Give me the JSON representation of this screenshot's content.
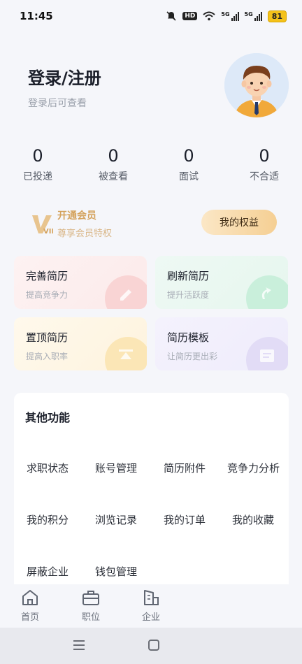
{
  "status_bar": {
    "time": "11:45",
    "hd": "HD",
    "net1": "5G",
    "net2": "5G",
    "battery": "81"
  },
  "profile": {
    "title": "登录/注册",
    "subtitle": "登录后可查看"
  },
  "stats": [
    {
      "value": "0",
      "label": "已投递"
    },
    {
      "value": "0",
      "label": "被查看"
    },
    {
      "value": "0",
      "label": "面试"
    },
    {
      "value": "0",
      "label": "不合适"
    }
  ],
  "vip": {
    "logo_text": "VIP",
    "title": "开通会员",
    "subtitle": "尊享会员特权",
    "button": "我的权益"
  },
  "cards": [
    {
      "title": "完善简历",
      "subtitle": "提高竞争力"
    },
    {
      "title": "刷新简历",
      "subtitle": "提升活跃度"
    },
    {
      "title": "置顶简历",
      "subtitle": "提高入职率"
    },
    {
      "title": "简历模板",
      "subtitle": "让简历更出彩"
    }
  ],
  "others": {
    "title": "其他功能",
    "items": [
      "求职状态",
      "账号管理",
      "简历附件",
      "竞争力分析",
      "我的积分",
      "浏览记录",
      "我的订单",
      "我的收藏",
      "屏蔽企业",
      "钱包管理"
    ]
  },
  "tabs": [
    {
      "label": "首页",
      "icon": "home-icon"
    },
    {
      "label": "职位",
      "icon": "briefcase-icon"
    },
    {
      "label": "企业",
      "icon": "building-icon"
    }
  ],
  "colors": {
    "vip_gold": "#d4a25c",
    "vip_button": "#f5cf93",
    "background": "#f5f6fa"
  }
}
